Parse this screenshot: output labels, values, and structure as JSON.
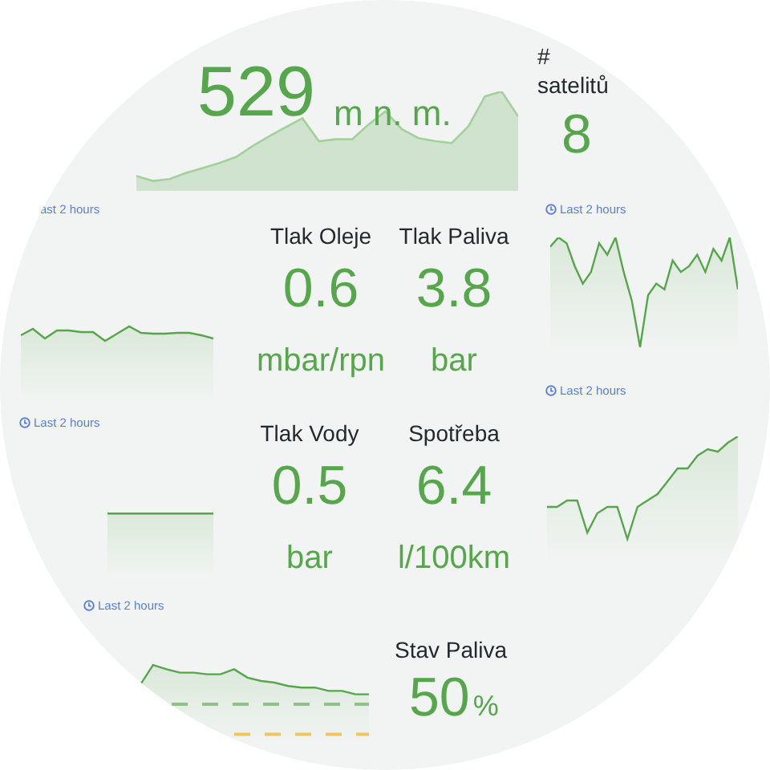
{
  "altitude": {
    "value": "529",
    "unit": "m n. m."
  },
  "satellites": {
    "title": "# satelitů",
    "value": "8"
  },
  "time_labels": [
    {
      "text": "ast 2 hours",
      "icon": false
    },
    {
      "text": "Last 2 hours",
      "icon": true
    },
    {
      "text": "Last 2 hours",
      "icon": true
    },
    {
      "text": "Last 2 hours",
      "icon": true
    },
    {
      "text": "Last 2 hours",
      "icon": true
    }
  ],
  "stats": [
    {
      "title": "Tlak Oleje",
      "value": "0.6",
      "unit": "mbar/rpn"
    },
    {
      "title": "Tlak Paliva",
      "value": "3.8",
      "unit": "bar"
    },
    {
      "title": "Tlak Vody",
      "value": "0.5",
      "unit": "bar"
    },
    {
      "title": "Spotřeba",
      "value": "6.4",
      "unit": "l/100km"
    }
  ],
  "fuel_level": {
    "title": "Stav Paliva",
    "value": "50",
    "unit": "%"
  }
}
